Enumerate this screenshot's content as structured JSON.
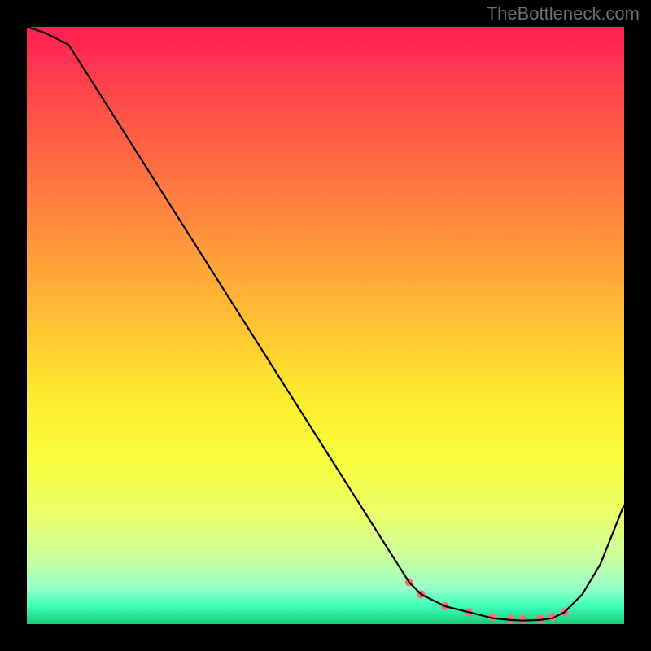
{
  "watermark": "TheBottleneck.com",
  "chart_data": {
    "type": "line",
    "title": "",
    "xlabel": "",
    "ylabel": "",
    "xlim": [
      0,
      100
    ],
    "ylim": [
      0,
      100
    ],
    "x": [
      0,
      3,
      7,
      64,
      66,
      70,
      74,
      78,
      81,
      83,
      86,
      88,
      90,
      93,
      96,
      100
    ],
    "values": [
      100,
      99,
      97,
      7,
      5,
      3,
      2,
      1,
      0.7,
      0.6,
      0.7,
      1,
      2,
      5,
      10,
      20
    ],
    "markers": {
      "x": [
        64,
        66,
        70,
        74,
        78,
        81,
        83,
        86,
        88,
        90
      ],
      "values": [
        7,
        5,
        3,
        2,
        1.2,
        0.9,
        0.8,
        0.9,
        1.2,
        2
      ],
      "color": "#ff6b78"
    },
    "line_color": "#000000",
    "background": "rainbow-vertical-gradient"
  }
}
